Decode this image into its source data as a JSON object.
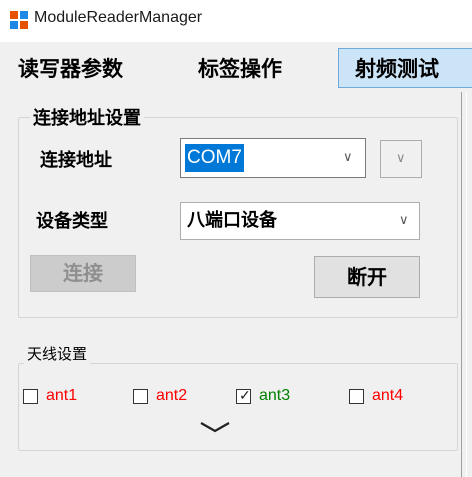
{
  "window": {
    "title": "ModuleReaderManager",
    "icon": "app-icon"
  },
  "tabs": [
    {
      "label": "读写器参数",
      "selected": false
    },
    {
      "label": "标签操作",
      "selected": false
    },
    {
      "label": "射频测试",
      "selected": true
    }
  ],
  "connection": {
    "group_title": "连接地址设置",
    "address_label": "连接地址",
    "address_value": "COM7",
    "device_type_label": "设备类型",
    "device_type_value": "八端口设备",
    "connect_label": "连接",
    "connect_enabled": false,
    "disconnect_label": "断开"
  },
  "antenna": {
    "group_title": "天线设置",
    "items": [
      {
        "label": "ant1",
        "checked": false,
        "color": "#ff0000"
      },
      {
        "label": "ant2",
        "checked": false,
        "color": "#ff0000"
      },
      {
        "label": "ant3",
        "checked": true,
        "color": "#008000"
      },
      {
        "label": "ant4",
        "checked": false,
        "color": "#ff0000"
      }
    ],
    "expand_icon": "chevron-down-icon"
  },
  "colors": {
    "selection": "#0078d7",
    "tab_selected": "#cce4f7",
    "window_bg": "#f0f0f0"
  }
}
